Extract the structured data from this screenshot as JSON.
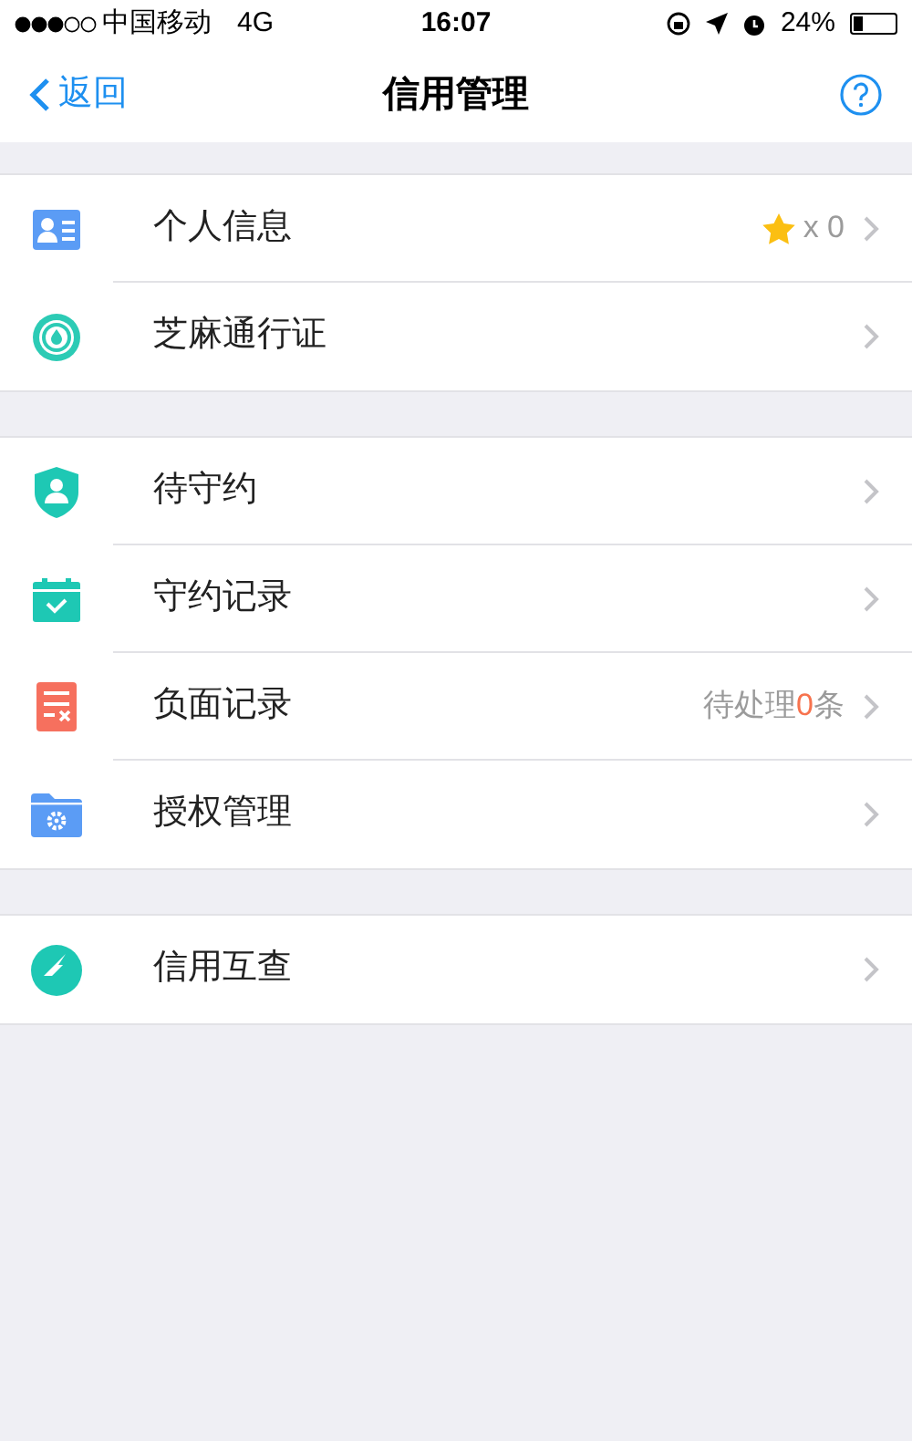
{
  "status_bar": {
    "carrier": "中国移动",
    "network": "4G",
    "time": "16:07",
    "battery": "24%"
  },
  "nav": {
    "back": "返回",
    "title": "信用管理"
  },
  "sections": [
    {
      "items": [
        {
          "label": "个人信息",
          "detail": {
            "kind": "stars",
            "text": "x 0"
          }
        },
        {
          "label": "芝麻通行证"
        }
      ]
    },
    {
      "items": [
        {
          "label": "待守约"
        },
        {
          "label": "守约记录"
        },
        {
          "label": "负面记录",
          "detail": {
            "kind": "parts",
            "parts": [
              {
                "text": "待处理",
                "highlight": false
              },
              {
                "text": "0",
                "highlight": true
              },
              {
                "text": "条",
                "highlight": false
              }
            ]
          }
        },
        {
          "label": "授权管理"
        }
      ]
    },
    {
      "items": [
        {
          "label": "信用互查"
        }
      ]
    }
  ]
}
